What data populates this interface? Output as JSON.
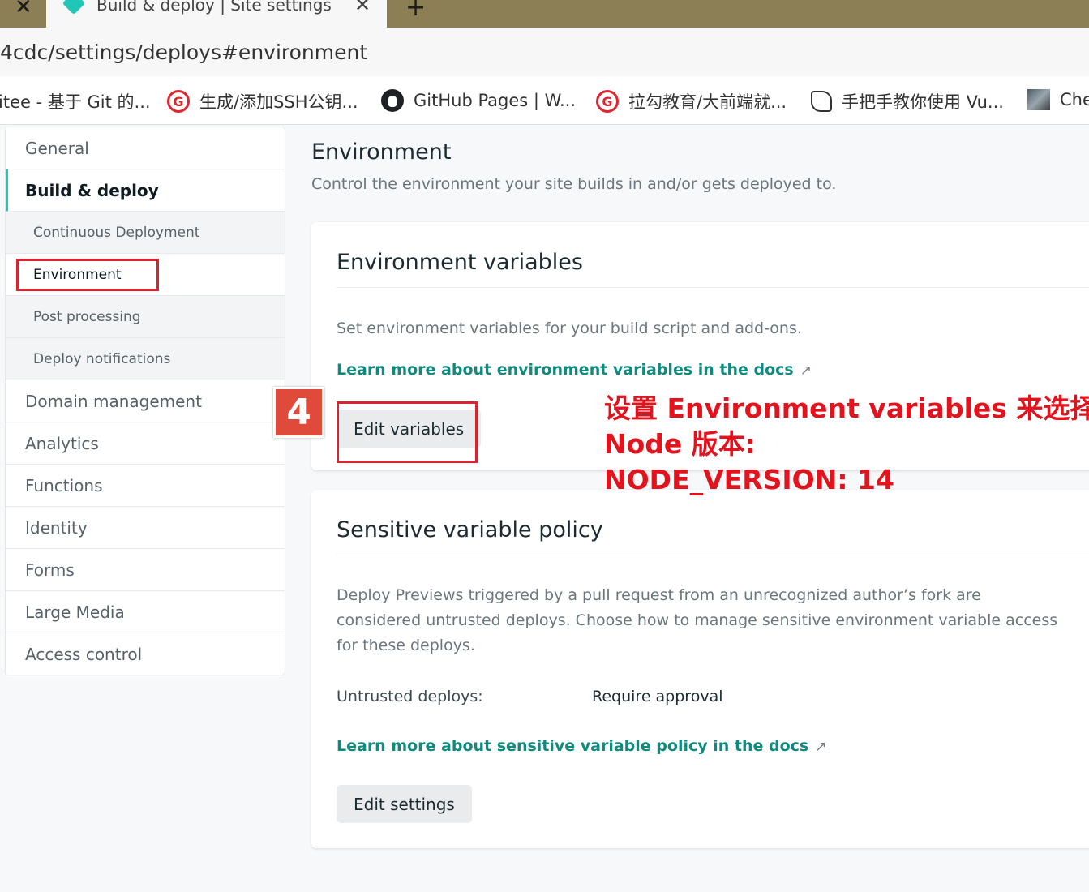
{
  "browser": {
    "tab": {
      "title": "Build & deploy | Site settings"
    },
    "address": {
      "url": "4cdc/settings/deploys#environment"
    },
    "bookmarks": [
      {
        "label": "itee - 基于 Git 的...",
        "icon": "gitee-icon"
      },
      {
        "label": "生成/添加SSH公钥...",
        "icon": "gitee-icon"
      },
      {
        "label": "GitHub Pages | W...",
        "icon": "github-icon"
      },
      {
        "label": "拉勾教育/大前端就...",
        "icon": "gitee-icon"
      },
      {
        "label": "手把手教你使用 Vu...",
        "icon": "vue-icon"
      },
      {
        "label": "Che",
        "icon": "image-thumbnail-icon"
      }
    ]
  },
  "sidebar": {
    "items": [
      {
        "label": "General"
      },
      {
        "label": "Build & deploy"
      },
      {
        "label": "Continuous Deployment"
      },
      {
        "label": "Environment"
      },
      {
        "label": "Post processing"
      },
      {
        "label": "Deploy notifications"
      },
      {
        "label": "Domain management"
      },
      {
        "label": "Analytics"
      },
      {
        "label": "Functions"
      },
      {
        "label": "Identity"
      },
      {
        "label": "Forms"
      },
      {
        "label": "Large Media"
      },
      {
        "label": "Access control"
      }
    ]
  },
  "main": {
    "title": "Environment",
    "description": "Control the environment your site builds in and/or gets deployed to.",
    "env_card": {
      "title": "Environment variables",
      "text": "Set environment variables for your build script and add-ons.",
      "link": "Learn more about environment variables in the docs",
      "link_arrow": "↗",
      "button": "Edit variables"
    },
    "policy_card": {
      "title": "Sensitive variable policy",
      "text": "Deploy Previews triggered by a pull request from an unrecognized author’s fork are considered untrusted deploys. Choose how to manage sensitive environment variable access for these deploys.",
      "untrusted_label": "Untrusted deploys:",
      "untrusted_value": "Require approval",
      "link": "Learn more about sensitive variable policy in the docs",
      "link_arrow": "↗",
      "button": "Edit settings"
    }
  },
  "annotation": {
    "step": "4",
    "lines": [
      "设置 Environment variables 来选择",
      "Node 版本:",
      "NODE_VERSION: 14"
    ],
    "color": "#e3131d"
  }
}
